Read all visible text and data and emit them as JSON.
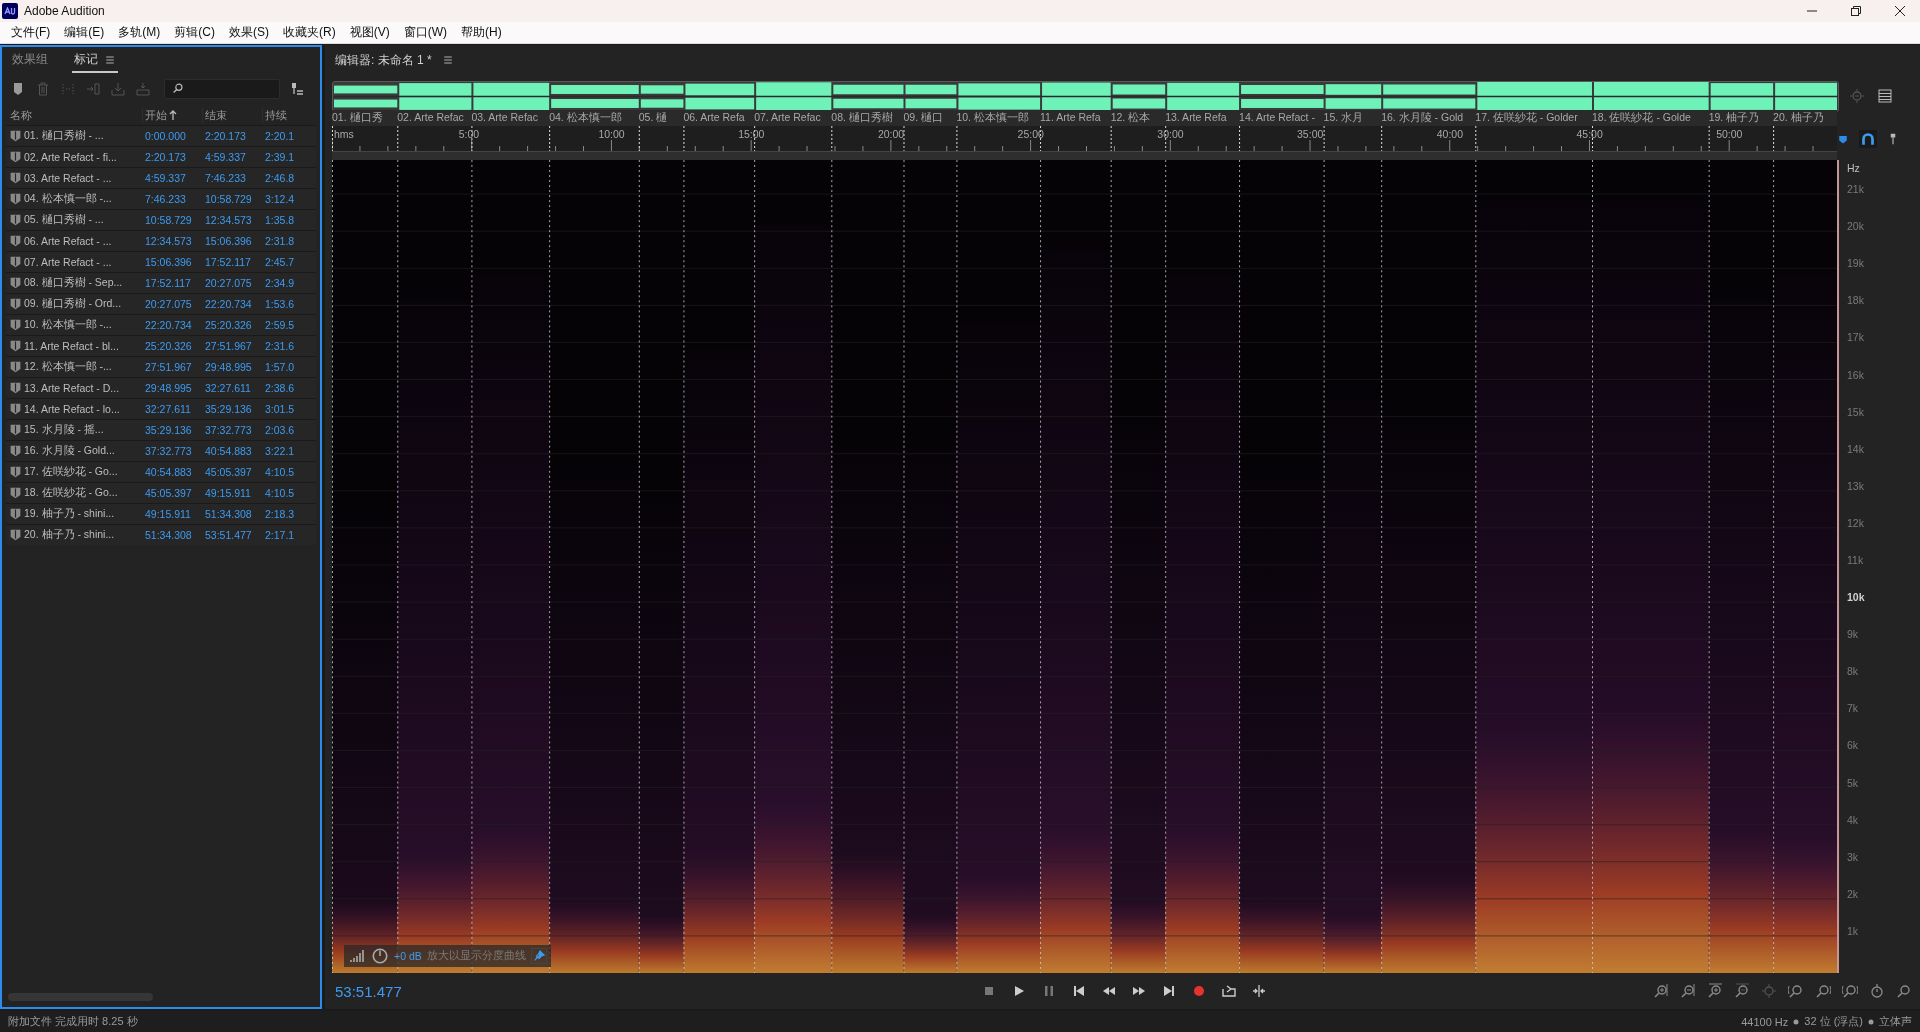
{
  "window": {
    "title": "Adobe Audition"
  },
  "menu": [
    "文件(F)",
    "编辑(E)",
    "多轨(M)",
    "剪辑(C)",
    "效果(S)",
    "收藏夹(R)",
    "视图(V)",
    "窗口(W)",
    "帮助(H)"
  ],
  "markers_panel": {
    "tabs": [
      {
        "label": "效果组",
        "selected": false
      },
      {
        "label": "标记",
        "selected": true
      }
    ],
    "columns": [
      {
        "label": "名称",
        "sorted": false
      },
      {
        "label": "开始",
        "sorted": true
      },
      {
        "label": "结束",
        "sorted": false
      },
      {
        "label": "持续",
        "sorted": false
      }
    ],
    "rows": [
      {
        "name": "01. 樋口秀樹 - ...",
        "start": "0:00.000",
        "end": "2:20.173",
        "duration": "2:20.1"
      },
      {
        "name": "02. Arte Refact - fi...",
        "start": "2:20.173",
        "end": "4:59.337",
        "duration": "2:39.1"
      },
      {
        "name": "03. Arte Refact - ...",
        "start": "4:59.337",
        "end": "7:46.233",
        "duration": "2:46.8"
      },
      {
        "name": "04. 松本慎一郎 -...",
        "start": "7:46.233",
        "end": "10:58.729",
        "duration": "3:12.4"
      },
      {
        "name": "05. 樋口秀樹 - ...",
        "start": "10:58.729",
        "end": "12:34.573",
        "duration": "1:35.8"
      },
      {
        "name": "06. Arte Refact - ...",
        "start": "12:34.573",
        "end": "15:06.396",
        "duration": "2:31.8"
      },
      {
        "name": "07. Arte Refact - ...",
        "start": "15:06.396",
        "end": "17:52.117",
        "duration": "2:45.7"
      },
      {
        "name": "08. 樋口秀樹 - Sep...",
        "start": "17:52.117",
        "end": "20:27.075",
        "duration": "2:34.9"
      },
      {
        "name": "09. 樋口秀樹 - Ord...",
        "start": "20:27.075",
        "end": "22:20.734",
        "duration": "1:53.6"
      },
      {
        "name": "10. 松本慎一郎 -...",
        "start": "22:20.734",
        "end": "25:20.326",
        "duration": "2:59.5"
      },
      {
        "name": "11. Arte Refact - bl...",
        "start": "25:20.326",
        "end": "27:51.967",
        "duration": "2:31.6"
      },
      {
        "name": "12. 松本慎一郎 -...",
        "start": "27:51.967",
        "end": "29:48.995",
        "duration": "1:57.0"
      },
      {
        "name": "13. Arte Refact - D...",
        "start": "29:48.995",
        "end": "32:27.611",
        "duration": "2:38.6"
      },
      {
        "name": "14. Arte Refact - lo...",
        "start": "32:27.611",
        "end": "35:29.136",
        "duration": "3:01.5"
      },
      {
        "name": "15. 水月陵 - 摇...",
        "start": "35:29.136",
        "end": "37:32.773",
        "duration": "2:03.6"
      },
      {
        "name": "16. 水月陵 - Gold...",
        "start": "37:32.773",
        "end": "40:54.883",
        "duration": "3:22.1"
      },
      {
        "name": "17. 佐咲紗花 - Go...",
        "start": "40:54.883",
        "end": "45:05.397",
        "duration": "4:10.5"
      },
      {
        "name": "18. 佐咲紗花 - Go...",
        "start": "45:05.397",
        "end": "49:15.911",
        "duration": "4:10.5"
      },
      {
        "name": "19. 柚子乃 - shini...",
        "start": "49:15.911",
        "end": "51:34.308",
        "duration": "2:18.3"
      },
      {
        "name": "20. 柚子乃 - shini...",
        "start": "51:34.308",
        "end": "53:51.477",
        "duration": "2:17.1"
      }
    ]
  },
  "editor": {
    "title": "编辑器: 未命名 1 *",
    "marker_labels": [
      "01. 樋口秀",
      "02. Arte Refac",
      "03. Arte Refac",
      "04. 松本慎一郎",
      "05. 樋",
      "06. Arte Refa",
      "07. Arte Refac",
      "08. 樋口秀樹",
      "09. 樋口",
      "10. 松本慎一郎",
      "11. Arte Refa",
      "12. 松本",
      "13. Arte Refa",
      "14. Arte Refact -",
      "15. 水月",
      "16. 水月陵 - Gold",
      "17. 佐咲紗花 - Golder",
      "18. 佐咲紗花 - Golde",
      "19. 柚子乃",
      "20. 柚子乃"
    ],
    "ruler": [
      "hms",
      "5:00",
      "10:00",
      "15:00",
      "20:00",
      "25:00",
      "30:00",
      "35:00",
      "40:00",
      "45:00",
      "50:00"
    ],
    "frequency_axis": {
      "unit": "Hz",
      "labels": [
        {
          "text": "21k",
          "bold": false
        },
        {
          "text": "20k",
          "bold": false
        },
        {
          "text": "19k",
          "bold": false
        },
        {
          "text": "18k",
          "bold": false
        },
        {
          "text": "17k",
          "bold": false
        },
        {
          "text": "16k",
          "bold": false
        },
        {
          "text": "15k",
          "bold": false
        },
        {
          "text": "14k",
          "bold": false
        },
        {
          "text": "13k",
          "bold": false
        },
        {
          "text": "12k",
          "bold": false
        },
        {
          "text": "11k",
          "bold": false
        },
        {
          "text": "10k",
          "bold": true
        },
        {
          "text": "9k",
          "bold": false
        },
        {
          "text": "8k",
          "bold": false
        },
        {
          "text": "7k",
          "bold": false
        },
        {
          "text": "6k",
          "bold": false
        },
        {
          "text": "5k",
          "bold": false
        },
        {
          "text": "4k",
          "bold": false
        },
        {
          "text": "3k",
          "bold": false
        },
        {
          "text": "2k",
          "bold": false
        },
        {
          "text": "1k",
          "bold": false
        }
      ]
    },
    "overlay": {
      "gain": "+0 dB",
      "hint": "放大以显示分度曲线"
    },
    "current_time": "53:51.477"
  },
  "status_bar": {
    "message": "附加文件 完成用时 8.25 秒",
    "sample_rate": "44100 Hz",
    "bit_depth": "32 位 (浮点)",
    "channels": "立体声"
  }
}
